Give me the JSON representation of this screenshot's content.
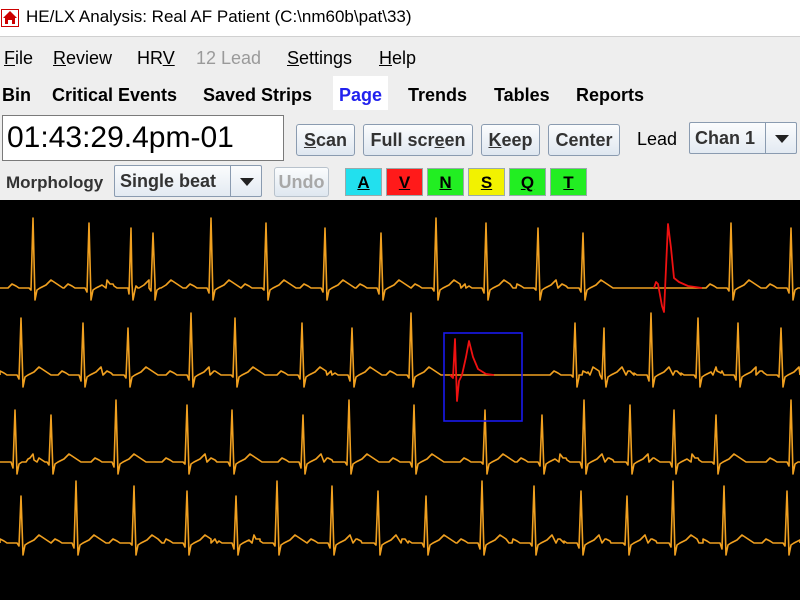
{
  "window": {
    "title": "HE/LX Analysis: Real AF Patient (C:\\nm60b\\pat\\33)"
  },
  "menu": [
    {
      "label": "File",
      "mnemonic": "F",
      "enabled": true
    },
    {
      "label": "Review",
      "mnemonic": "R",
      "enabled": true
    },
    {
      "label": "HRV",
      "mnemonic": "V",
      "enabled": true
    },
    {
      "label": "12 Lead",
      "mnemonic": "",
      "enabled": false
    },
    {
      "label": "Settings",
      "mnemonic": "S",
      "enabled": true
    },
    {
      "label": "Help",
      "mnemonic": "H",
      "enabled": true
    }
  ],
  "tabs": [
    {
      "label": "Bin",
      "active": false
    },
    {
      "label": "Critical Events",
      "active": false
    },
    {
      "label": "Saved Strips",
      "active": false
    },
    {
      "label": "Page",
      "active": true
    },
    {
      "label": "Trends",
      "active": false
    },
    {
      "label": "Tables",
      "active": false
    },
    {
      "label": "Reports",
      "active": false
    }
  ],
  "toolbar": {
    "time_value": "01:43:29.4pm-01",
    "scan_label": "Scan",
    "fullscreen_label": "Full screen",
    "keep_label": "Keep",
    "center_label": "Center",
    "lead_label": "Lead",
    "lead_value": "Chan 1",
    "morphology_label": "Morphology",
    "morphology_value": "Single beat",
    "undo_label": "Undo"
  },
  "classify_buttons": [
    {
      "label": "A",
      "color": "#22e0ee"
    },
    {
      "label": "V",
      "color": "#ff1a1a"
    },
    {
      "label": "N",
      "color": "#22ee22"
    },
    {
      "label": "S",
      "color": "#f2f200"
    },
    {
      "label": "Q",
      "color": "#22ee22"
    },
    {
      "label": "T",
      "color": "#22ee22"
    }
  ],
  "colors": {
    "trace": "#f0a020",
    "highlight": "#ee1111",
    "selection_box": "#1a1aee",
    "background": "#000000",
    "active_tab": "#2222ee"
  },
  "ecg": {
    "rows": 4,
    "beats": [
      [
        32,
        88,
        130,
        152,
        210,
        265,
        324,
        380,
        435,
        485,
        537,
        582,
        634,
        730,
        790
      ],
      [
        20,
        82,
        127,
        190,
        234,
        301,
        351,
        410,
        470,
        574,
        603,
        650,
        697,
        737,
        780
      ],
      [
        14,
        50,
        115,
        186,
        231,
        302,
        348,
        413,
        484,
        541,
        583,
        629,
        673,
        715,
        790
      ],
      [
        20,
        75,
        133,
        186,
        235,
        276,
        331,
        377,
        425,
        481,
        533,
        580,
        626,
        672,
        723,
        786
      ]
    ],
    "ectopic_beats": [
      {
        "row": 0,
        "at": 668
      },
      {
        "row": 1,
        "at": 460
      }
    ],
    "selected_beat": {
      "row": 1,
      "at": 460
    }
  }
}
